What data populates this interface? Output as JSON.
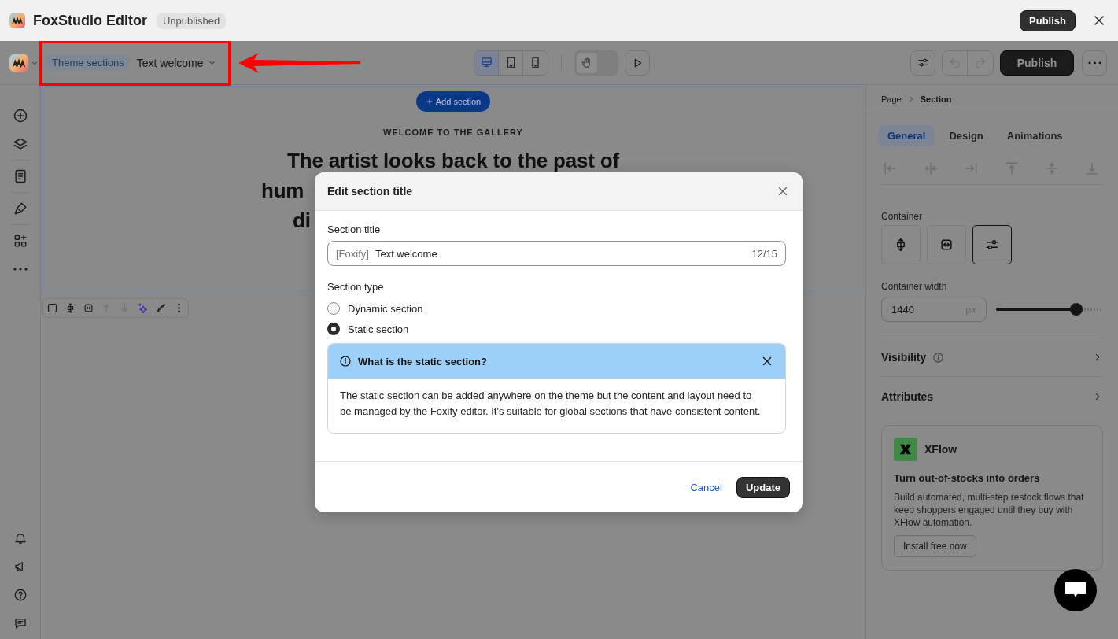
{
  "app": {
    "title": "FoxStudio Editor",
    "status": "Unpublished",
    "publish": "Publish"
  },
  "toolbar": {
    "chip": "Theme sections",
    "section_name": "Text welcome",
    "devices": [
      {
        "kind": "desktop",
        "selected": true
      },
      {
        "kind": "tablet",
        "selected": false
      },
      {
        "kind": "mobile",
        "selected": false
      }
    ],
    "hand_tool": {
      "on": false
    },
    "history": [
      {
        "kind": "undo",
        "disabled": true
      },
      {
        "kind": "redo",
        "disabled": true
      }
    ],
    "publish": "Publish"
  },
  "canvas": {
    "add_section": "Add section",
    "eyebrow": "WELCOME TO THE GALLERY",
    "heading_lines": [
      "The artist looks back to the past of",
      "hum",
      "di"
    ],
    "section_tools": [
      {
        "kind": "select",
        "disabled": false
      },
      {
        "kind": "vertical",
        "disabled": false
      },
      {
        "kind": "horizontal",
        "disabled": false
      },
      {
        "kind": "up",
        "disabled": true
      },
      {
        "kind": "down",
        "disabled": true
      },
      {
        "kind": "ai",
        "disabled": false
      },
      {
        "kind": "brush",
        "disabled": false
      },
      {
        "kind": "more",
        "disabled": false
      }
    ]
  },
  "panel": {
    "breadcrumb": [
      "Page",
      "Section"
    ],
    "tabs": [
      {
        "label": "General",
        "selected": true
      },
      {
        "label": "Design",
        "selected": false
      },
      {
        "label": "Animations",
        "selected": false
      }
    ],
    "container_label": "Container",
    "container_options": [
      {
        "kind": "vertical",
        "selected": false
      },
      {
        "kind": "horizontal",
        "selected": false
      },
      {
        "kind": "custom",
        "selected": true
      }
    ],
    "width_label": "Container width",
    "width_value": "1440",
    "width_unit": "px",
    "width_slider": {
      "level": 0.77
    },
    "sections": [
      {
        "label": "Visibility",
        "info": true
      },
      {
        "label": "Attributes",
        "info": false
      }
    ],
    "promo": {
      "name": "XFlow",
      "title": "Turn out-of-stocks into orders",
      "text": "Build automated, multi-step restock flows that keep shoppers engaged until they buy with XFlow automation.",
      "button": "Install free now"
    }
  },
  "modal": {
    "title": "Edit section title",
    "field_label": "Section title",
    "prefix": "[Foxify]",
    "value": "Text welcome",
    "counter": "12/15",
    "type_label": "Section type",
    "options": [
      {
        "label": "Dynamic section",
        "selected": false
      },
      {
        "label": "Static section",
        "selected": true
      }
    ],
    "info": {
      "title": "What is the static section?",
      "text": "The static section can be added anywhere on the theme but the content and layout need to be managed by the Foxify editor. It's suitable for global sections that have consistent content."
    },
    "cancel": "Cancel",
    "update": "Update"
  }
}
